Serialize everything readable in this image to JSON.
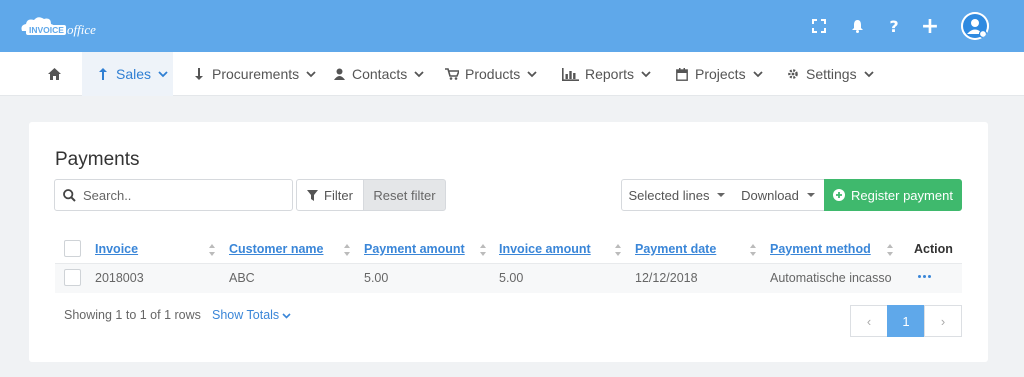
{
  "app": {
    "logo_text": "INVOICE office"
  },
  "topbar": {
    "icons": [
      "fullscreen-icon",
      "bell-icon",
      "help-icon",
      "plus-icon",
      "user-avatar-icon"
    ],
    "help_glyph": "?",
    "plus_glyph": "+"
  },
  "nav": {
    "home_icon": "home-icon",
    "items": [
      {
        "label": "Sales",
        "icon": "arrow-up-icon",
        "active": true
      },
      {
        "label": "Procurements",
        "icon": "arrow-down-icon"
      },
      {
        "label": "Contacts",
        "icon": "user-icon"
      },
      {
        "label": "Products",
        "icon": "cart-icon"
      },
      {
        "label": "Reports",
        "icon": "bar-chart-icon"
      },
      {
        "label": "Projects",
        "icon": "calendar-icon"
      },
      {
        "label": "Settings",
        "icon": "gear-icon"
      }
    ]
  },
  "page": {
    "title": "Payments"
  },
  "toolbar": {
    "search_placeholder": "Search..",
    "filter_label": "Filter",
    "reset_label": "Reset filter",
    "selected_lines_label": "Selected lines",
    "download_label": "Download",
    "register_label": "Register payment"
  },
  "table": {
    "columns": [
      "Invoice",
      "Customer name",
      "Payment amount",
      "Invoice amount",
      "Payment date",
      "Payment method",
      "Action"
    ],
    "rows": [
      [
        "2018003",
        "ABC",
        "5.00",
        "5.00",
        "12/12/2018",
        "Automatische incasso"
      ]
    ]
  },
  "footer": {
    "rows_info": "Showing 1 to 1 of 1 rows",
    "show_totals": "Show Totals",
    "pager": {
      "prev": "‹",
      "current": "1",
      "next": "›"
    }
  },
  "colors": {
    "topbar": "#5fa8ea",
    "link": "#3a86d8",
    "register": "#3fb96d"
  }
}
